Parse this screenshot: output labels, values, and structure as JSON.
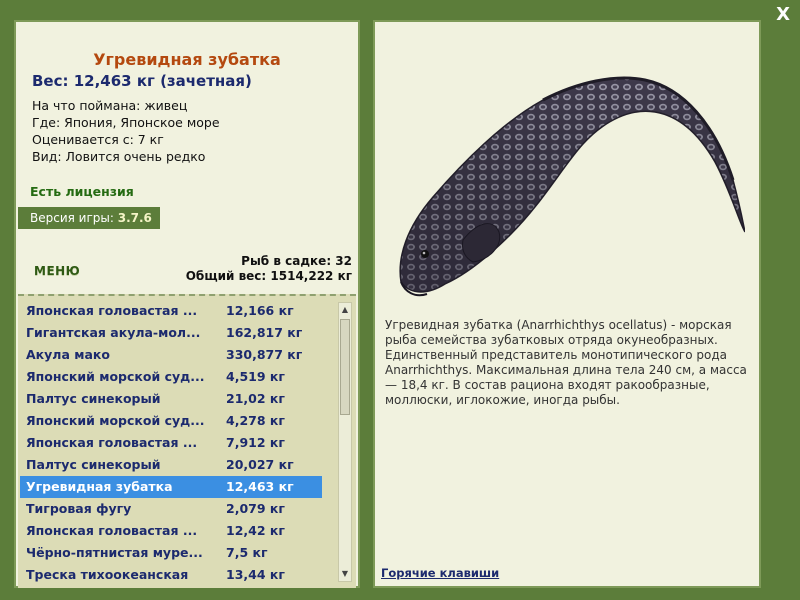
{
  "close_label": "X",
  "fish": {
    "name": "Угревидная зубатка",
    "weight_line": "Вес: 12,463 кг (зачетная)",
    "info": [
      "На что поймана: живец",
      "Где: Япония, Японское море",
      "Оценивается с: 7 кг",
      "Вид: Ловится очень редко"
    ]
  },
  "license": "Есть лицензия",
  "version": {
    "label": "Версия игры: ",
    "value": "3.7.6"
  },
  "menu_label": "МЕНЮ",
  "keepnet": {
    "count_line": "Рыб в садке: 32",
    "total_line": "Общий вес: 1514,222 кг"
  },
  "catch_list": [
    {
      "name": "Японская головастая ...",
      "weight": "12,166 кг"
    },
    {
      "name": "Гигантская акула-мол...",
      "weight": "162,817 кг"
    },
    {
      "name": "Акула мако",
      "weight": "330,877 кг"
    },
    {
      "name": "Японский морской суд...",
      "weight": "4,519 кг"
    },
    {
      "name": "Палтус синекорый",
      "weight": "21,02 кг"
    },
    {
      "name": "Японский морской суд...",
      "weight": "4,278 кг"
    },
    {
      "name": "Японская головастая ...",
      "weight": "7,912 кг"
    },
    {
      "name": "Палтус синекорый",
      "weight": "20,027 кг"
    },
    {
      "name": "Угревидная зубатка",
      "weight": "12,463 кг",
      "selected": true
    },
    {
      "name": "Тигровая фугу",
      "weight": "2,079 кг"
    },
    {
      "name": "Японская головастая ...",
      "weight": "12,42 кг"
    },
    {
      "name": "Чёрно-пятнистая муре...",
      "weight": "7,5 кг"
    },
    {
      "name": "Треска тихоокеанская",
      "weight": "13,44 кг"
    }
  ],
  "description": "Угревидная зубатка (Anarrhichthys ocellatus) - морская рыба семейства зубатковых отряда окунеобразных. Единственный представитель монотипического рода Anarrhichthys. Максимальная длина тела 240 см, а масса — 18,4 кг. В состав рациона входят ракообразные, моллюски, иглокожие, иногда рыбы.",
  "hotkeys_label": "Горячие клавиши",
  "colors": {
    "background": "#5c7d3a",
    "panel": "#f1f2df",
    "fish_name": "#b4490f",
    "list_text": "#1c2a6e",
    "selection": "#3b8fe2"
  }
}
